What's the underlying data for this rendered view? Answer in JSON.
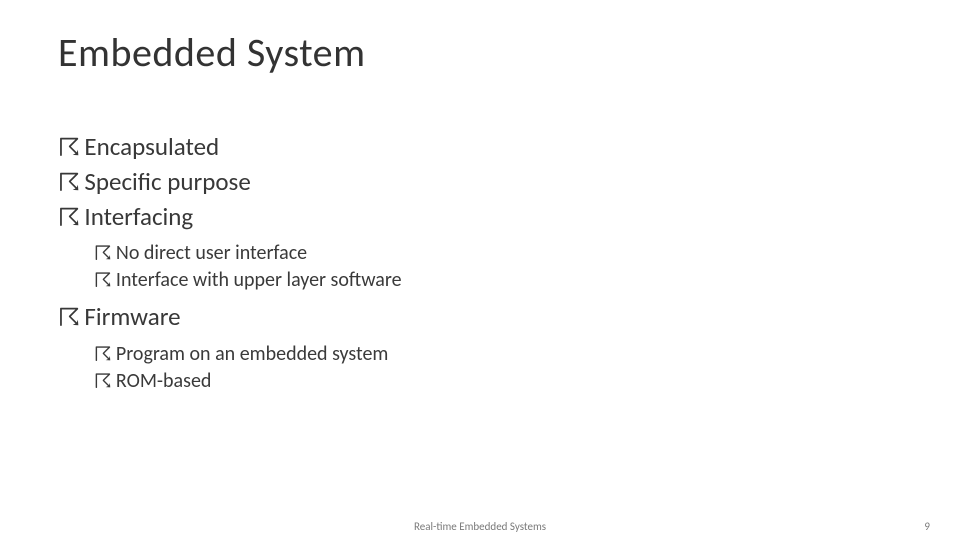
{
  "title": "Embedded System",
  "bullet_glyph": "☈",
  "items": {
    "encapsulated": "Encapsulated",
    "specific": "Specific purpose",
    "interfacing": "Interfacing",
    "no_direct": "No direct user interface",
    "interface_upper": "Interface with upper layer software",
    "firmware": "Firmware",
    "program": "Program on an embedded system",
    "rom": "ROM-based"
  },
  "footer": {
    "center": "Real-time Embedded Systems",
    "page": "9"
  }
}
